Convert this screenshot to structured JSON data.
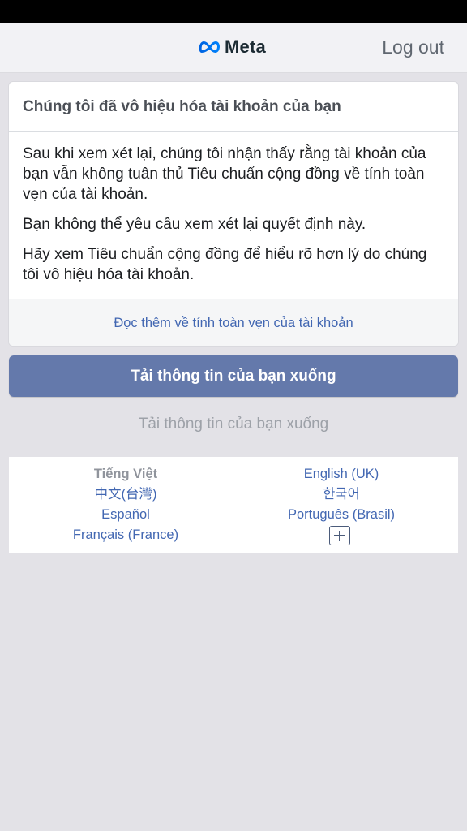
{
  "header": {
    "brand": "Meta",
    "logout_label": "Log out"
  },
  "card": {
    "title": "Chúng tôi đã vô hiệu hóa tài khoản của bạn",
    "paragraphs": [
      "Sau khi xem xét lại, chúng tôi nhận thấy rằng tài khoản của bạn vẫn không tuân thủ Tiêu chuẩn cộng đồng về tính toàn vẹn của tài khoản.",
      "Bạn không thể yêu cầu xem xét lại quyết định này.",
      "Hãy xem Tiêu chuẩn cộng đồng để hiểu rõ hơn lý do chúng tôi vô hiệu hóa tài khoản."
    ],
    "footer_link": "Đọc thêm về tính toàn vẹn của tài khoản"
  },
  "actions": {
    "primary_label": "Tải thông tin của bạn xuống",
    "secondary_label": "Tải thông tin của bạn xuống"
  },
  "languages": {
    "current": "Tiếng Việt",
    "left": [
      "中文(台灣)",
      "Español",
      "Français (France)"
    ],
    "right": [
      "English (UK)",
      "한국어",
      "Português (Brasil)"
    ],
    "more_icon": "plus-box-icon"
  },
  "colors": {
    "link": "#4267b2",
    "primary_button": "#6479ab",
    "background": "#e3e2e7"
  }
}
